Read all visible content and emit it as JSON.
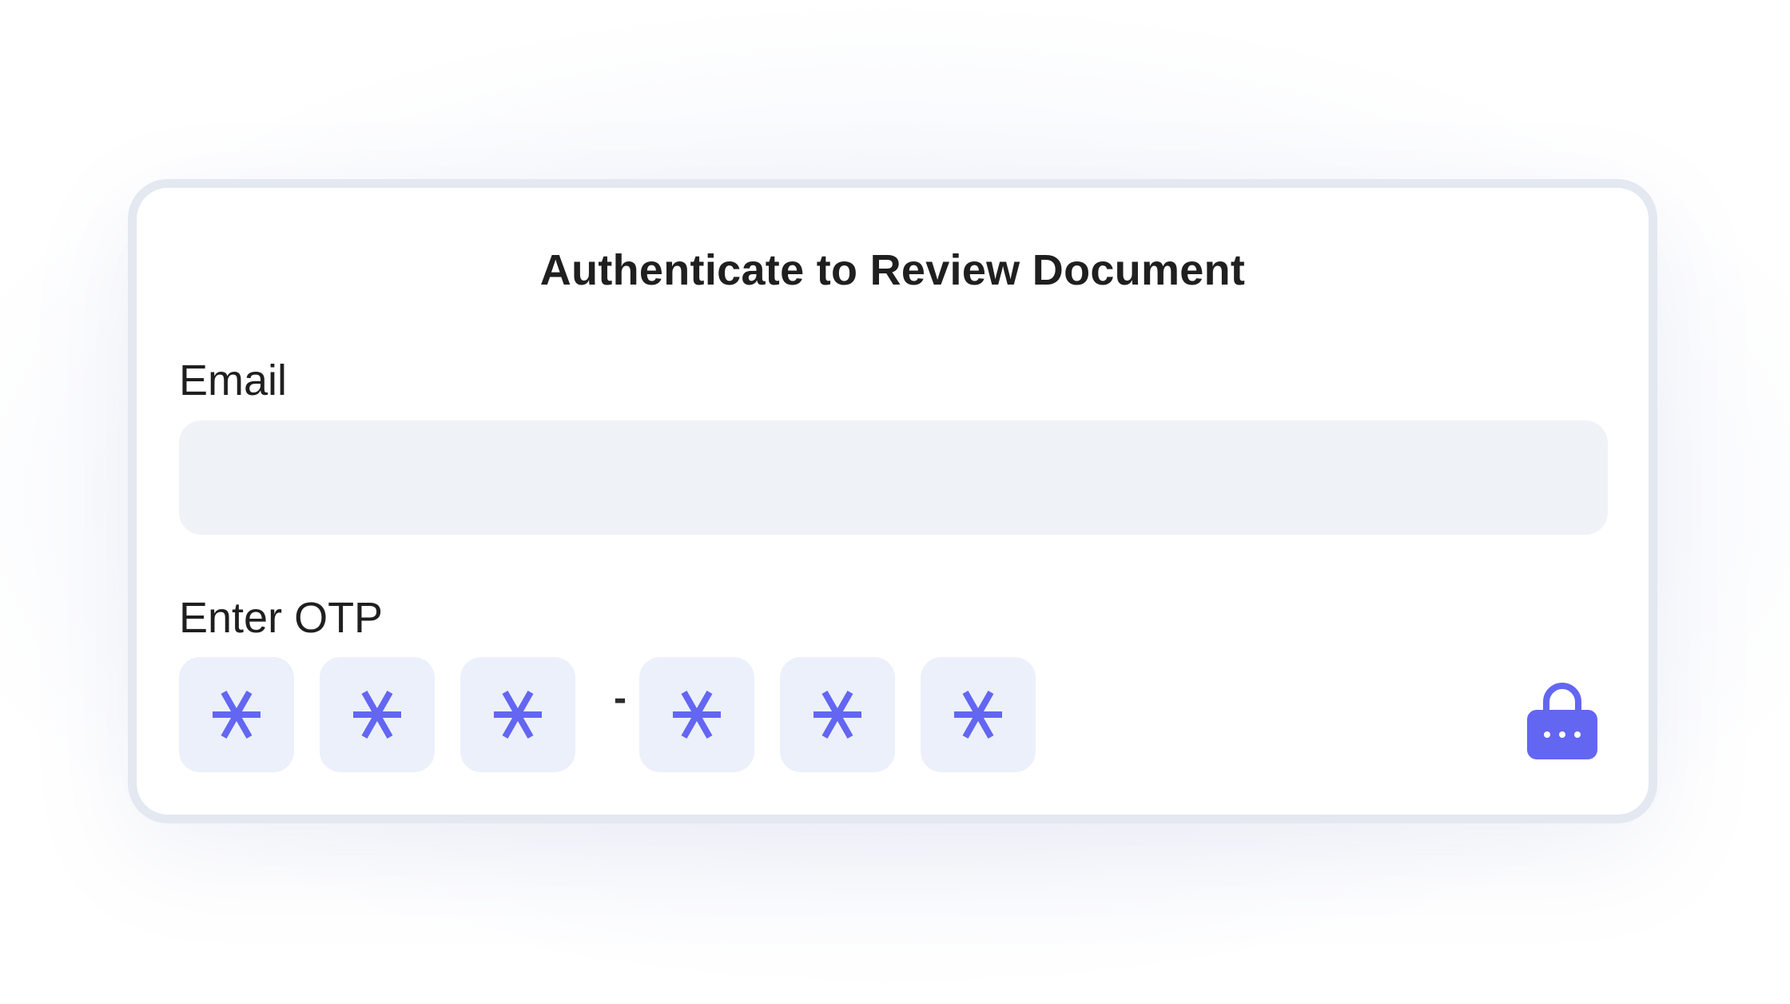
{
  "dialog": {
    "title": "Authenticate to Review Document"
  },
  "email": {
    "label": "Email",
    "value": "",
    "placeholder": ""
  },
  "otp": {
    "label": "Enter OTP",
    "digits": [
      "*",
      "*",
      "*",
      "*",
      "*",
      "*"
    ],
    "separator": "-"
  },
  "icons": {
    "mask": "asterisk-icon",
    "action": "lock-icon"
  },
  "colors": {
    "accent": "#6366f1",
    "otp_box_bg": "#ecf0fb",
    "input_bg": "#eff2f7",
    "card_border": "#e3e8f1",
    "text": "#1f1f1f"
  }
}
